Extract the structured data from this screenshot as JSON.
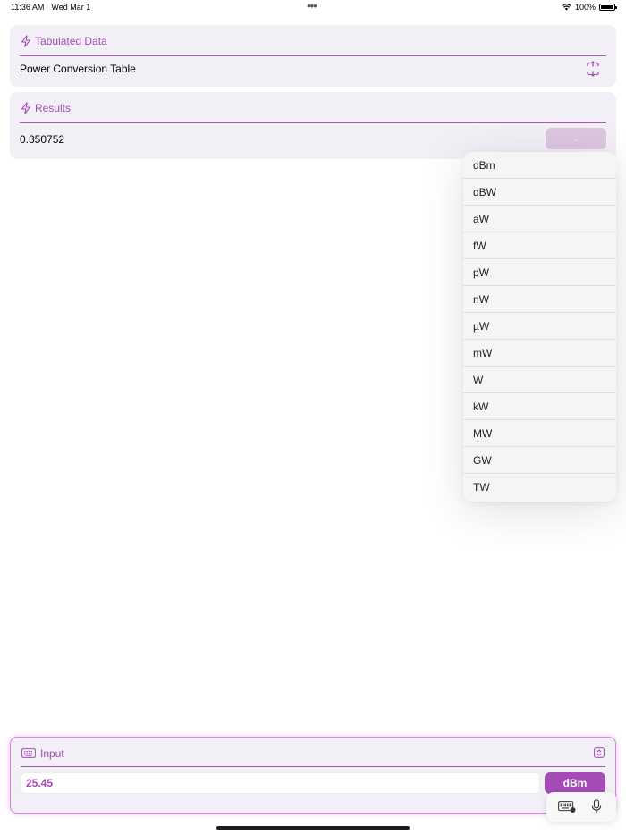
{
  "status_bar": {
    "time": "11:36 AM",
    "date": "Wed Mar 1",
    "battery": "100%"
  },
  "tabulated": {
    "title": "Tabulated Data",
    "row_label": "Power Conversion Table"
  },
  "results": {
    "title": "Results",
    "value": "0.350752"
  },
  "unit_menu": {
    "items": [
      "dBm",
      "dBW",
      "aW",
      "fW",
      "pW",
      "nW",
      "µW",
      "mW",
      "W",
      "kW",
      "MW",
      "GW",
      "TW"
    ]
  },
  "input": {
    "title": "Input",
    "value": "25.45",
    "unit": "dBm"
  },
  "colors": {
    "accent": "#a54bb5",
    "card_background": "#f2f0f6",
    "input_glow": "#d785e3"
  },
  "icons": {
    "tabulated_header": "bolt-icon",
    "results_header": "bolt-icon",
    "tabulated_action": "expand-icon",
    "input_header": "keyboard-icon",
    "input_action": "stepper-icon",
    "assistant_keyboard": "keyboard-dismiss-icon",
    "assistant_mic": "microphone-icon"
  }
}
